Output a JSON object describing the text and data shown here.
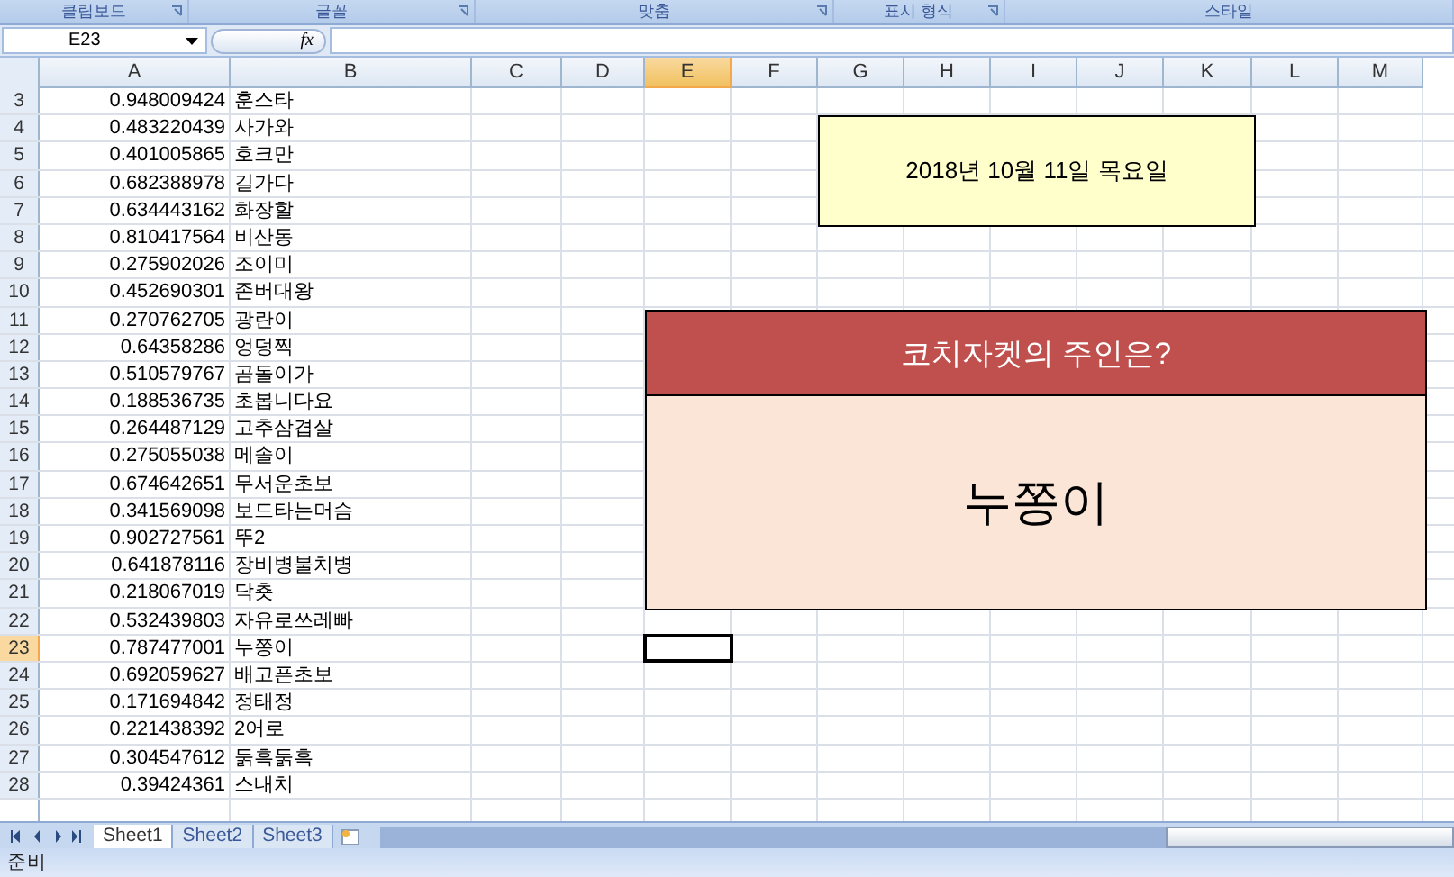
{
  "ribbon_groups": [
    {
      "label": "클립보드",
      "launcher": true
    },
    {
      "label": "글꼴",
      "launcher": true
    },
    {
      "label": "맞춤",
      "launcher": true
    },
    {
      "label": "표시 형식",
      "launcher": true
    },
    {
      "label": "스타일",
      "launcher": false
    }
  ],
  "name_box": "E23",
  "formula_icon": "fx",
  "columns": [
    {
      "label": "A",
      "selected": false
    },
    {
      "label": "B",
      "selected": false
    },
    {
      "label": "C",
      "selected": false
    },
    {
      "label": "D",
      "selected": false
    },
    {
      "label": "E",
      "selected": true
    },
    {
      "label": "F",
      "selected": false
    },
    {
      "label": "G",
      "selected": false
    },
    {
      "label": "H",
      "selected": false
    },
    {
      "label": "I",
      "selected": false
    },
    {
      "label": "J",
      "selected": false
    },
    {
      "label": "K",
      "selected": false
    },
    {
      "label": "L",
      "selected": false
    },
    {
      "label": "M",
      "selected": false
    }
  ],
  "rows": [
    {
      "number": "3",
      "a": "0.948009424",
      "b": "훈스타",
      "selected": false
    },
    {
      "number": "4",
      "a": "0.483220439",
      "b": "사가와",
      "selected": false
    },
    {
      "number": "5",
      "a": "0.401005865",
      "b": "호크만",
      "selected": false
    },
    {
      "number": "6",
      "a": "0.682388978",
      "b": "길가다",
      "selected": false
    },
    {
      "number": "7",
      "a": "0.634443162",
      "b": "화장할",
      "selected": false
    },
    {
      "number": "8",
      "a": "0.810417564",
      "b": "비산동",
      "selected": false
    },
    {
      "number": "9",
      "a": "0.275902026",
      "b": "조이미",
      "selected": false
    },
    {
      "number": "10",
      "a": "0.452690301",
      "b": "존버대왕",
      "selected": false
    },
    {
      "number": "11",
      "a": "0.270762705",
      "b": "광란이",
      "selected": false
    },
    {
      "number": "12",
      "a": "0.64358286",
      "b": "엉덩찍",
      "selected": false
    },
    {
      "number": "13",
      "a": "0.510579767",
      "b": "곰돌이가",
      "selected": false
    },
    {
      "number": "14",
      "a": "0.188536735",
      "b": "초봅니다요",
      "selected": false
    },
    {
      "number": "15",
      "a": "0.264487129",
      "b": "고추삼겹살",
      "selected": false
    },
    {
      "number": "16",
      "a": "0.275055038",
      "b": "메솔이",
      "selected": false
    },
    {
      "number": "17",
      "a": "0.674642651",
      "b": "무서운초보",
      "selected": false
    },
    {
      "number": "18",
      "a": "0.341569098",
      "b": "보드타는머슴",
      "selected": false
    },
    {
      "number": "19",
      "a": "0.902727561",
      "b": "뚜2",
      "selected": false
    },
    {
      "number": "20",
      "a": "0.641878116",
      "b": "장비병불치병",
      "selected": false
    },
    {
      "number": "21",
      "a": "0.218067019",
      "b": "닥춋",
      "selected": false
    },
    {
      "number": "22",
      "a": "0.532439803",
      "b": "자유로쓰레빠",
      "selected": false
    },
    {
      "number": "23",
      "a": "0.787477001",
      "b": "누쫑이",
      "selected": true
    },
    {
      "number": "24",
      "a": "0.692059627",
      "b": "배고픈초보",
      "selected": false
    },
    {
      "number": "25",
      "a": "0.171694842",
      "b": "정태정",
      "selected": false
    },
    {
      "number": "26",
      "a": "0.221438392",
      "b": "2어로",
      "selected": false
    },
    {
      "number": "27",
      "a": "0.304547612",
      "b": "둙흑둙흑",
      "selected": false
    },
    {
      "number": "28",
      "a": "0.39424361",
      "b": "스내치",
      "selected": false
    }
  ],
  "date_box": {
    "text": "2018년 10월 11일 목요일"
  },
  "question_box": {
    "title": "코치자켓의 주인은?",
    "answer": "누쫑이"
  },
  "sheet_tabs": [
    {
      "label": "Sheet1",
      "selected": true
    },
    {
      "label": "Sheet2",
      "selected": false
    },
    {
      "label": "Sheet3",
      "selected": false
    }
  ],
  "status_bar": {
    "text": "준비"
  }
}
